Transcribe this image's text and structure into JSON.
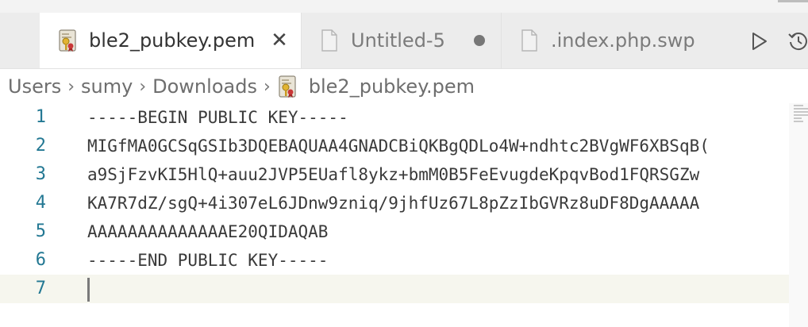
{
  "tabs": [
    {
      "label": "ble2_pubkey.pem",
      "active": true,
      "icon": "certificate-key-icon",
      "close": "✕"
    },
    {
      "label": "Untitled-5",
      "active": false,
      "icon": "file-icon",
      "dirty": true
    },
    {
      "label": ".index.php.swp",
      "active": false,
      "icon": "file-icon"
    }
  ],
  "toolbar": {
    "run_icon": "play-icon",
    "history_icon": "history-icon"
  },
  "breadcrumb": [
    "Users",
    "sumy",
    "Downloads",
    "ble2_pubkey.pem"
  ],
  "editor": {
    "lines": [
      {
        "num": "1",
        "text": "-----BEGIN PUBLIC KEY-----"
      },
      {
        "num": "2",
        "text": "MIGfMA0GCSqGSIb3DQEBAQUAA4GNADCBiQKBgQDLo4W+ndhtc2BVgWF6XBSqB("
      },
      {
        "num": "3",
        "text": "a9SjFzvKI5HlQ+auu2JVP5EUafl8ykz+bmM0B5FeEvugdeKpqvBod1FQRSGZw"
      },
      {
        "num": "4",
        "text": "KA7R7dZ/sgQ+4i307eL6JDnw9zniq/9jhfUz67L8pZzIbGVRz8uDF8DgAAAAA"
      },
      {
        "num": "5",
        "text": "AAAAAAAAAAAAAAE20QIDAQAB"
      },
      {
        "num": "6",
        "text": "-----END PUBLIC KEY-----"
      },
      {
        "num": "7",
        "text": ""
      }
    ],
    "current_line": 7
  },
  "colors": {
    "line_number": "#237893",
    "tab_bar": "#ececec",
    "current_line": "#f6f6ee"
  }
}
